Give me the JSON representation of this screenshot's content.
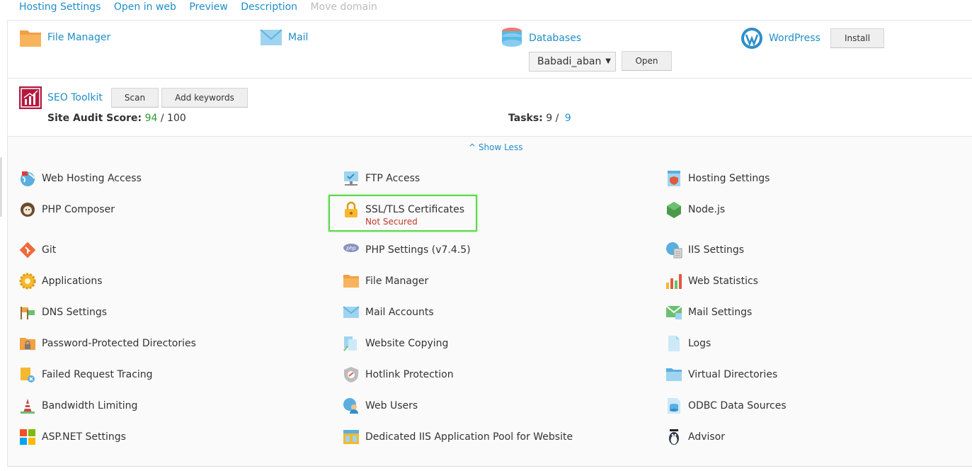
{
  "top_links": [
    "Hosting Settings",
    "Open in web",
    "Preview",
    "Description",
    "Move domain"
  ],
  "tools": {
    "file_manager": "File Manager",
    "mail": "Mail",
    "databases": "Databases",
    "db_select": "Babadi_aban",
    "open_button": "Open",
    "wordpress": "WordPress",
    "install_button": "Install"
  },
  "seo": {
    "title": "SEO Toolkit",
    "scan": "Scan",
    "add_keywords": "Add keywords",
    "audit_label": "Site Audit Score:",
    "audit_score": "94",
    "audit_max": "/ 100",
    "tasks_label": "Tasks:",
    "tasks_done": "9 /",
    "tasks_total": "9"
  },
  "show_less": "Show Less",
  "grid": {
    "col1": [
      "Web Hosting Access",
      "PHP Composer",
      "Git",
      "Applications",
      "DNS Settings",
      "Password-Protected Directories",
      "Failed Request Tracing",
      "Bandwidth Limiting",
      "ASP.NET Settings"
    ],
    "col2": [
      "FTP Access",
      "SSL/TLS Certificates",
      "PHP Settings (v7.4.5)",
      "File Manager",
      "Mail Accounts",
      "Website Copying",
      "Hotlink Protection",
      "Web Users",
      "Dedicated IIS Application Pool for Website"
    ],
    "col3": [
      "Hosting Settings",
      "Node.js",
      "IIS Settings",
      "Web Statistics",
      "Mail Settings",
      "Logs",
      "Virtual Directories",
      "ODBC Data Sources",
      "Advisor"
    ],
    "ssl_status": "Not Secured"
  },
  "colors": {
    "link": "#1f8ec8",
    "highlight": "#5ad84a",
    "warning": "#c0392b",
    "score": "#2d9a2d"
  }
}
